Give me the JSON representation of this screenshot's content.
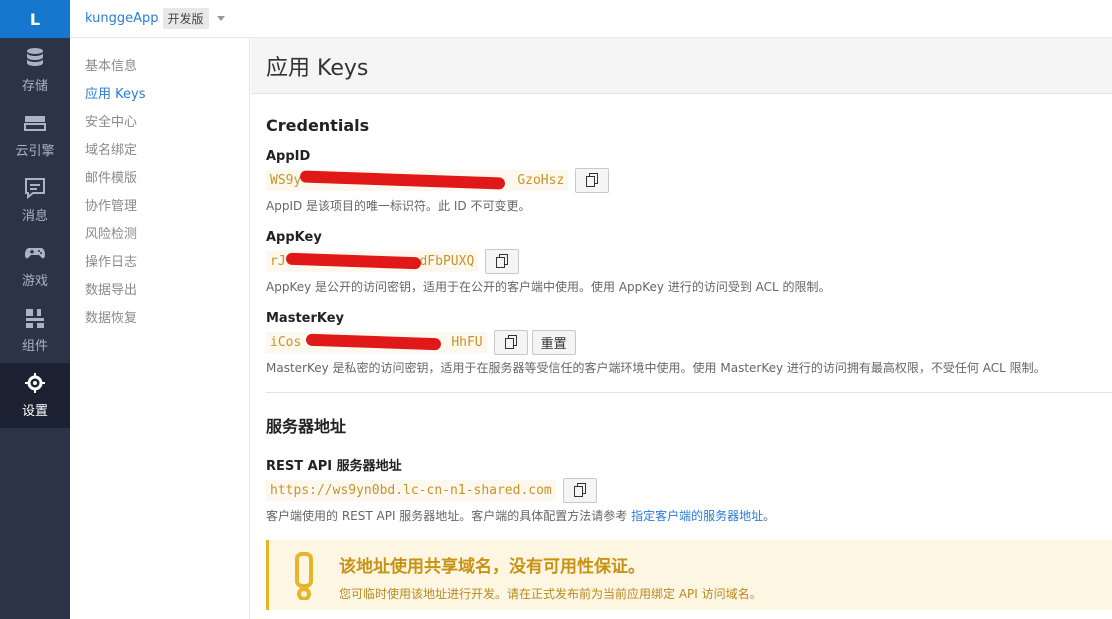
{
  "rail": {
    "logo": "L",
    "items": [
      {
        "label": "存储",
        "icon": "database-icon"
      },
      {
        "label": "云引擎",
        "icon": "cloud-engine-icon"
      },
      {
        "label": "消息",
        "icon": "message-icon"
      },
      {
        "label": "游戏",
        "icon": "gamepad-icon"
      },
      {
        "label": "组件",
        "icon": "components-icon"
      },
      {
        "label": "设置",
        "icon": "gear-icon",
        "active": true
      }
    ]
  },
  "topbar": {
    "app_name": "kunggeApp",
    "edition": "开发版"
  },
  "subnav": {
    "items": [
      "基本信息",
      "应用 Keys",
      "安全中心",
      "域名绑定",
      "邮件模版",
      "协作管理",
      "风险检测",
      "操作日志",
      "数据导出",
      "数据恢复"
    ],
    "active_index": 1
  },
  "page": {
    "title": "应用 Keys"
  },
  "credentials": {
    "title": "Credentials",
    "appid": {
      "label": "AppID",
      "value": "WS9y...GzoHsz",
      "value_visible_start": "WS9y",
      "value_visible_end": "GzoHsz",
      "help": "AppID 是该项目的唯一标识符。此 ID 不可变更。"
    },
    "appkey": {
      "label": "AppKey",
      "value_visible_start": "rJ",
      "value_visible_end": "sdFbPUXQ",
      "help": "AppKey 是公开的访问密钥，适用于在公开的客户端中使用。使用 AppKey 进行的访问受到 ACL 的限制。"
    },
    "masterkey": {
      "label": "MasterKey",
      "value_visible_start": "iCos",
      "value_visible_end": "HhFU",
      "reset_label": "重置",
      "help": "MasterKey 是私密的访问密钥，适用于在服务器等受信任的客户端环境中使用。使用 MasterKey 进行的访问拥有最高权限，不受任何 ACL 限制。"
    }
  },
  "server": {
    "title": "服务器地址",
    "rest_label": "REST API 服务器地址",
    "rest_url": "https://ws9yn0bd.lc-cn-n1-shared.com",
    "help_prefix": "客户端使用的 REST API 服务器地址。客户端的具体配置方法请参考 ",
    "help_link": "指定客户端的服务器地址",
    "help_suffix": "。"
  },
  "warning": {
    "title": "该地址使用共享域名，没有可用性保证。",
    "subtitle": "您可临时使用该地址进行开发。请在正式发布前为当前应用绑定 API 访问域名。"
  },
  "colors": {
    "rail_bg": "#2b3346",
    "logo_bg": "#1677cf",
    "link": "#2b7bd6",
    "code_text": "#c7942a",
    "warning_border": "#e7b42b"
  }
}
